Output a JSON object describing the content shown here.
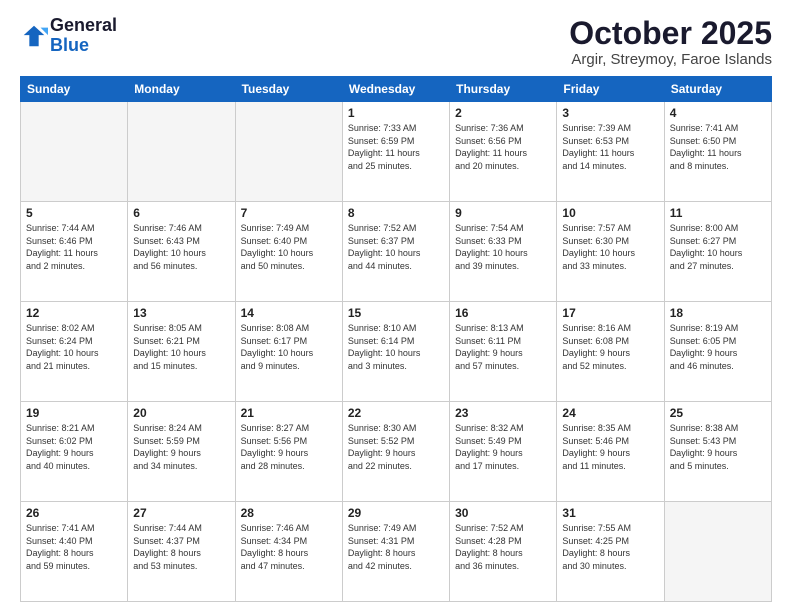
{
  "logo": {
    "general": "General",
    "blue": "Blue"
  },
  "title": "October 2025",
  "subtitle": "Argir, Streymoy, Faroe Islands",
  "days_of_week": [
    "Sunday",
    "Monday",
    "Tuesday",
    "Wednesday",
    "Thursday",
    "Friday",
    "Saturday"
  ],
  "weeks": [
    [
      {
        "day": "",
        "info": ""
      },
      {
        "day": "",
        "info": ""
      },
      {
        "day": "",
        "info": ""
      },
      {
        "day": "1",
        "info": "Sunrise: 7:33 AM\nSunset: 6:59 PM\nDaylight: 11 hours\nand 25 minutes."
      },
      {
        "day": "2",
        "info": "Sunrise: 7:36 AM\nSunset: 6:56 PM\nDaylight: 11 hours\nand 20 minutes."
      },
      {
        "day": "3",
        "info": "Sunrise: 7:39 AM\nSunset: 6:53 PM\nDaylight: 11 hours\nand 14 minutes."
      },
      {
        "day": "4",
        "info": "Sunrise: 7:41 AM\nSunset: 6:50 PM\nDaylight: 11 hours\nand 8 minutes."
      }
    ],
    [
      {
        "day": "5",
        "info": "Sunrise: 7:44 AM\nSunset: 6:46 PM\nDaylight: 11 hours\nand 2 minutes."
      },
      {
        "day": "6",
        "info": "Sunrise: 7:46 AM\nSunset: 6:43 PM\nDaylight: 10 hours\nand 56 minutes."
      },
      {
        "day": "7",
        "info": "Sunrise: 7:49 AM\nSunset: 6:40 PM\nDaylight: 10 hours\nand 50 minutes."
      },
      {
        "day": "8",
        "info": "Sunrise: 7:52 AM\nSunset: 6:37 PM\nDaylight: 10 hours\nand 44 minutes."
      },
      {
        "day": "9",
        "info": "Sunrise: 7:54 AM\nSunset: 6:33 PM\nDaylight: 10 hours\nand 39 minutes."
      },
      {
        "day": "10",
        "info": "Sunrise: 7:57 AM\nSunset: 6:30 PM\nDaylight: 10 hours\nand 33 minutes."
      },
      {
        "day": "11",
        "info": "Sunrise: 8:00 AM\nSunset: 6:27 PM\nDaylight: 10 hours\nand 27 minutes."
      }
    ],
    [
      {
        "day": "12",
        "info": "Sunrise: 8:02 AM\nSunset: 6:24 PM\nDaylight: 10 hours\nand 21 minutes."
      },
      {
        "day": "13",
        "info": "Sunrise: 8:05 AM\nSunset: 6:21 PM\nDaylight: 10 hours\nand 15 minutes."
      },
      {
        "day": "14",
        "info": "Sunrise: 8:08 AM\nSunset: 6:17 PM\nDaylight: 10 hours\nand 9 minutes."
      },
      {
        "day": "15",
        "info": "Sunrise: 8:10 AM\nSunset: 6:14 PM\nDaylight: 10 hours\nand 3 minutes."
      },
      {
        "day": "16",
        "info": "Sunrise: 8:13 AM\nSunset: 6:11 PM\nDaylight: 9 hours\nand 57 minutes."
      },
      {
        "day": "17",
        "info": "Sunrise: 8:16 AM\nSunset: 6:08 PM\nDaylight: 9 hours\nand 52 minutes."
      },
      {
        "day": "18",
        "info": "Sunrise: 8:19 AM\nSunset: 6:05 PM\nDaylight: 9 hours\nand 46 minutes."
      }
    ],
    [
      {
        "day": "19",
        "info": "Sunrise: 8:21 AM\nSunset: 6:02 PM\nDaylight: 9 hours\nand 40 minutes."
      },
      {
        "day": "20",
        "info": "Sunrise: 8:24 AM\nSunset: 5:59 PM\nDaylight: 9 hours\nand 34 minutes."
      },
      {
        "day": "21",
        "info": "Sunrise: 8:27 AM\nSunset: 5:56 PM\nDaylight: 9 hours\nand 28 minutes."
      },
      {
        "day": "22",
        "info": "Sunrise: 8:30 AM\nSunset: 5:52 PM\nDaylight: 9 hours\nand 22 minutes."
      },
      {
        "day": "23",
        "info": "Sunrise: 8:32 AM\nSunset: 5:49 PM\nDaylight: 9 hours\nand 17 minutes."
      },
      {
        "day": "24",
        "info": "Sunrise: 8:35 AM\nSunset: 5:46 PM\nDaylight: 9 hours\nand 11 minutes."
      },
      {
        "day": "25",
        "info": "Sunrise: 8:38 AM\nSunset: 5:43 PM\nDaylight: 9 hours\nand 5 minutes."
      }
    ],
    [
      {
        "day": "26",
        "info": "Sunrise: 7:41 AM\nSunset: 4:40 PM\nDaylight: 8 hours\nand 59 minutes."
      },
      {
        "day": "27",
        "info": "Sunrise: 7:44 AM\nSunset: 4:37 PM\nDaylight: 8 hours\nand 53 minutes."
      },
      {
        "day": "28",
        "info": "Sunrise: 7:46 AM\nSunset: 4:34 PM\nDaylight: 8 hours\nand 47 minutes."
      },
      {
        "day": "29",
        "info": "Sunrise: 7:49 AM\nSunset: 4:31 PM\nDaylight: 8 hours\nand 42 minutes."
      },
      {
        "day": "30",
        "info": "Sunrise: 7:52 AM\nSunset: 4:28 PM\nDaylight: 8 hours\nand 36 minutes."
      },
      {
        "day": "31",
        "info": "Sunrise: 7:55 AM\nSunset: 4:25 PM\nDaylight: 8 hours\nand 30 minutes."
      },
      {
        "day": "",
        "info": ""
      }
    ]
  ]
}
